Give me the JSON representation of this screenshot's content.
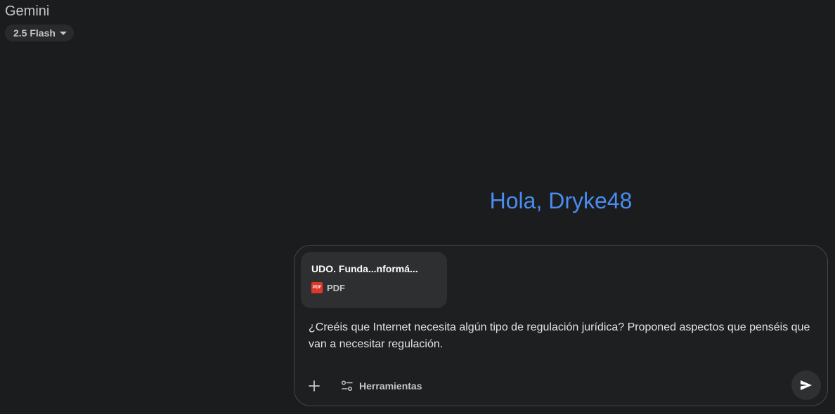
{
  "app": {
    "title": "Gemini"
  },
  "model_selector": {
    "label": "2.5 Flash",
    "icon": "caret-down-icon"
  },
  "greeting": {
    "text": "Hola, Dryke48",
    "color": "#4a8cf0"
  },
  "composer": {
    "attachment": {
      "name": "UDO. Funda...nformá...",
      "type": "PDF",
      "icon": "pdf-icon",
      "icon_label": "PDF"
    },
    "prompt": "¿Creéis que Internet necesita algún tipo de regulación jurídica? Proponed aspectos que penséis que van a necesitar regulación.",
    "add_icon": "plus-icon",
    "tools": {
      "label": "Herramientas",
      "icon": "sliders-icon"
    },
    "send_icon": "send-icon"
  }
}
